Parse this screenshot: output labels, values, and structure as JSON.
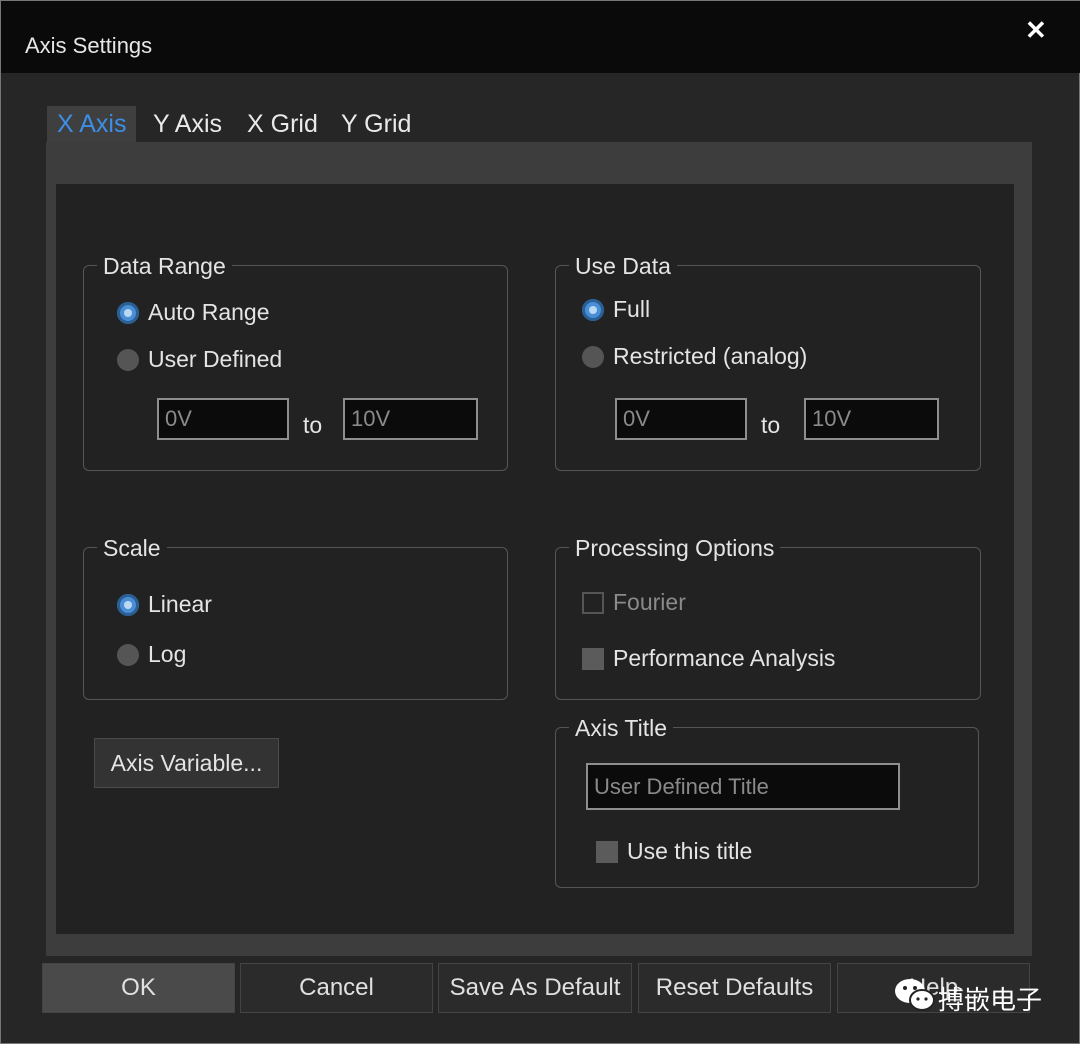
{
  "window": {
    "title": "Axis Settings",
    "close_glyph": "✕"
  },
  "tabs": [
    {
      "label": "X Axis",
      "active": true
    },
    {
      "label": "Y Axis",
      "active": false
    },
    {
      "label": "X Grid",
      "active": false
    },
    {
      "label": "Y Grid",
      "active": false
    }
  ],
  "data_range": {
    "title": "Data Range",
    "options": [
      {
        "label": "Auto Range",
        "selected": true
      },
      {
        "label": "User Defined",
        "selected": false
      }
    ],
    "from_value": "0V",
    "to_label": "to",
    "to_value": "10V"
  },
  "use_data": {
    "title": "Use Data",
    "options": [
      {
        "label": "Full",
        "selected": true
      },
      {
        "label": "Restricted (analog)",
        "selected": false
      }
    ],
    "from_value": "0V",
    "to_label": "to",
    "to_value": "10V"
  },
  "scale": {
    "title": "Scale",
    "options": [
      {
        "label": "Linear",
        "selected": true
      },
      {
        "label": "Log",
        "selected": false
      }
    ]
  },
  "processing": {
    "title": "Processing Options",
    "fourier_label": "Fourier",
    "fourier_enabled": false,
    "performance_label": "Performance Analysis",
    "performance_checked": false
  },
  "axis_title": {
    "title": "Axis Title",
    "field_value": "User Defined Title",
    "use_label": "Use this title",
    "use_checked": false
  },
  "axis_variable_button": "Axis Variable...",
  "buttons": {
    "ok": "OK",
    "cancel": "Cancel",
    "save_default": "Save As Default",
    "reset_defaults": "Reset Defaults",
    "help": "Help"
  },
  "watermark": {
    "text": "搏嵌电子",
    "icon": "wechat-icon"
  },
  "colors": {
    "accent": "#3d8ee6",
    "background": "#262626",
    "titlebar": "#0a0a0a"
  }
}
